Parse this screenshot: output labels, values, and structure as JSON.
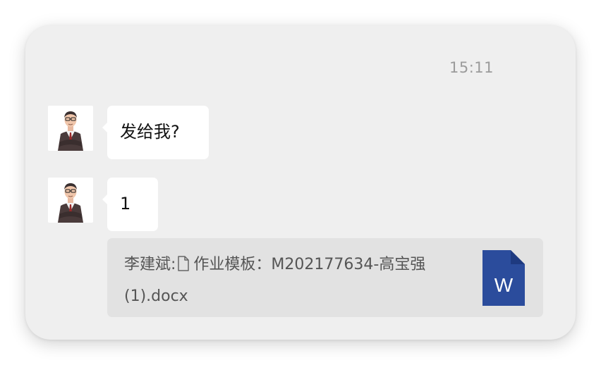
{
  "chat": {
    "timestamp": "15:11",
    "messages": [
      {
        "sender_avatar": "avatar",
        "text": "发给我?"
      },
      {
        "sender_avatar": "avatar",
        "text": "1"
      }
    ],
    "quote": {
      "sender": "李建斌:",
      "file_icon": "document-icon",
      "filename_line1": "作业模板：M202177634-高宝强",
      "filename_line2": "(1).docx",
      "file_type_icon": "word-file-icon",
      "file_type_letter": "W"
    }
  },
  "colors": {
    "card_background": "#efefef",
    "bubble_background": "#ffffff",
    "quote_background": "#e2e2e2",
    "word_blue": "#2b4c9c"
  }
}
